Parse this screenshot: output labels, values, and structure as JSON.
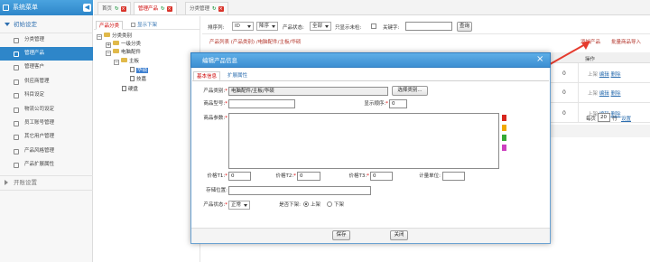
{
  "sidebar": {
    "title": "系统菜单",
    "toggle_glyph": "◀",
    "group_open": "初始设定",
    "items": [
      {
        "label": "分类管理"
      },
      {
        "label": "管理产品",
        "active": true
      },
      {
        "label": "管理客户"
      },
      {
        "label": "供应商管理"
      },
      {
        "label": "科目设定"
      },
      {
        "label": "物流公司设定"
      },
      {
        "label": "员工账号管理"
      },
      {
        "label": "其它用户管理"
      },
      {
        "label": "产品风格管理"
      },
      {
        "label": "产品扩展属性"
      }
    ],
    "group_collapsed": "开账设置"
  },
  "tabs": [
    {
      "label": "首页"
    },
    {
      "label": "管理产品",
      "active": true
    },
    {
      "label": "分类管理"
    }
  ],
  "tree": {
    "tab_active": "产品分类",
    "tab_other": "显示下架",
    "root": "分类类别",
    "nodes": [
      {
        "label": "一级分类",
        "depth": 1,
        "kind": "plus"
      },
      {
        "label": "电脑配件",
        "depth": 1,
        "kind": "minus"
      },
      {
        "label": "主板",
        "depth": 2,
        "kind": "minus"
      },
      {
        "label": "华硕",
        "depth": 3,
        "kind": "doc",
        "selected": true
      },
      {
        "label": "技嘉",
        "depth": 3,
        "kind": "doc"
      },
      {
        "label": "硬盘",
        "depth": 2,
        "kind": "doc"
      }
    ]
  },
  "filter": {
    "sort_label": "排序列:",
    "sort_value": "ID",
    "order_value": "降序",
    "status_label": "产品状态:",
    "status_value": "全部",
    "checkbox_label": "只显示未检:",
    "keyword_label": "关键字:",
    "keyword_value": "",
    "query_button": "查询"
  },
  "grid": {
    "breadcrumb": "产品列表 (产品类别) /电脑配件/主板/华硕",
    "add_link": "添加产品",
    "import_link": "批量商品导入",
    "col_header": "操作",
    "rows": [
      {
        "count": "0",
        "actions": [
          "上架",
          "编辑",
          "删除"
        ]
      },
      {
        "count": "0",
        "actions": [
          "上架",
          "编辑",
          "删除"
        ]
      },
      {
        "count": "0",
        "actions": [
          "上架",
          "编辑",
          "删除"
        ]
      }
    ],
    "pager_prefix": "每页",
    "pager_value": "20",
    "pager_suffix": "行",
    "pager_settings": "设置"
  },
  "modal": {
    "title": "编辑产品信息",
    "close_glyph": "×",
    "tab_basic": "基本信息",
    "tab_ext": "扩展属性",
    "category_label": "产品类别:",
    "category_value": "电脑配件/主板/华硕",
    "choose_button": "选择类别...",
    "code_label": "商品型号:",
    "code_value": "",
    "order_label": "显示顺序:",
    "order_value": "0",
    "params_label": "商品参数:",
    "params_value": "",
    "price1_label": "价格T1:",
    "price1_value": "0",
    "price2_label": "价格T2:",
    "price2_value": "0",
    "price3_label": "价格T3:",
    "price3_value": "0",
    "unit_label": "计量单位:",
    "unit_value": "",
    "storage_label": "存储位置:",
    "storage_value": "",
    "status_label": "产品状态:",
    "status_value": "正常",
    "shelf_label": "是否下架:",
    "shelf_on": "上架",
    "shelf_off": "下架",
    "save_button": "保存",
    "close_button": "关闭",
    "colors": [
      "#d7261e",
      "#f0a800",
      "#36a935",
      "#cc3fbf"
    ]
  },
  "annotation_arrow_color": "#e53b2e"
}
